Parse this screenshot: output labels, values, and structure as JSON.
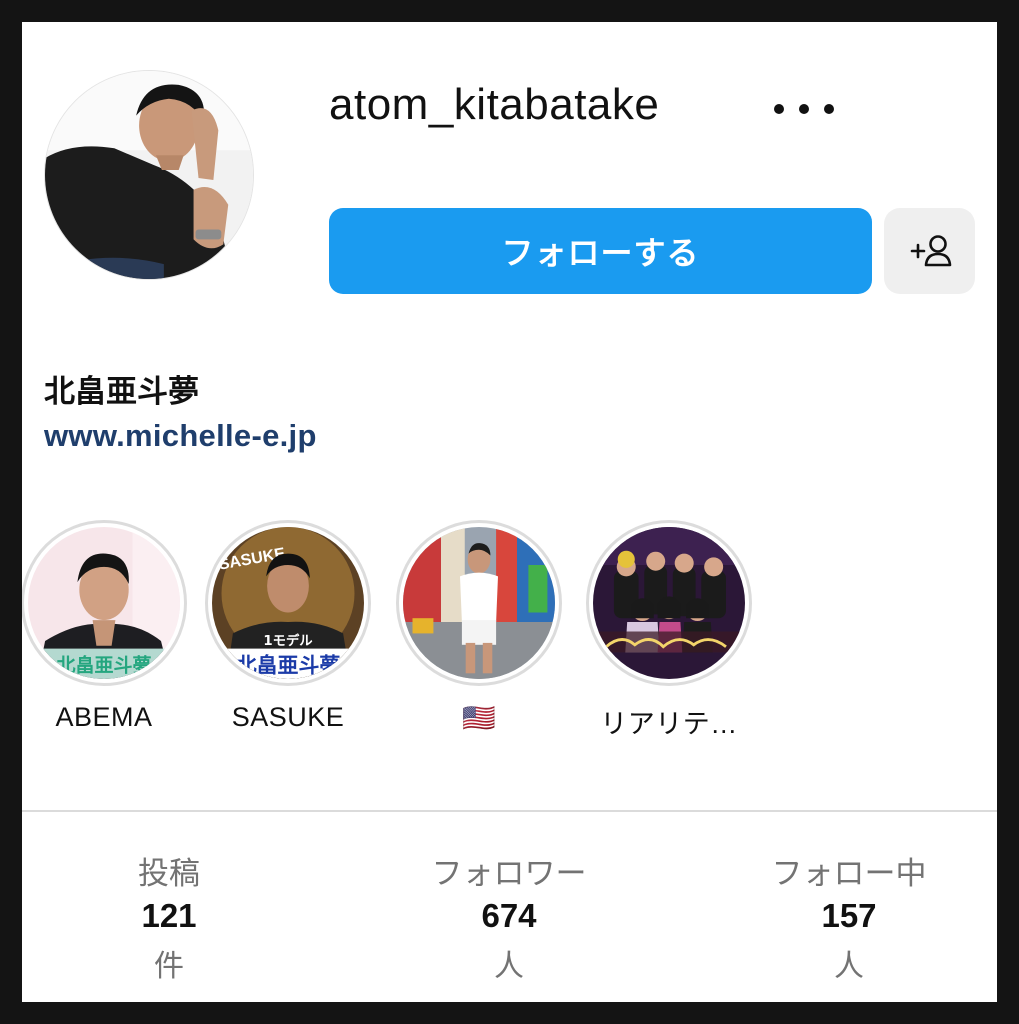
{
  "profile": {
    "username": "atom_kitabatake",
    "full_name": "北畠亜斗夢",
    "website": "www.michelle-e.jp",
    "avatar_icon": "profile-photo",
    "more_icon": "more-horizontal-icon"
  },
  "actions": {
    "follow_label": "フォローする",
    "add_person_icon": "add-person-icon"
  },
  "highlights": [
    {
      "label": "ABEMA",
      "thumb_text": "北畠亜斗夢"
    },
    {
      "label": "SASUKE",
      "thumb_text": "北畠亜斗夢",
      "thumb_badge": "SASUKE",
      "thumb_sub": "1モデル"
    },
    {
      "label": "🇺🇸"
    },
    {
      "label": "リアリテ…"
    }
  ],
  "stats": [
    {
      "label": "投稿",
      "count": "121",
      "unit": "件"
    },
    {
      "label": "フォロワー",
      "count": "674",
      "unit": "人"
    },
    {
      "label": "フォロー中",
      "count": "157",
      "unit": "人"
    }
  ],
  "colors": {
    "follow_button": "#1a9bf0",
    "link": "#1f3e6c",
    "muted_text": "#737373"
  }
}
